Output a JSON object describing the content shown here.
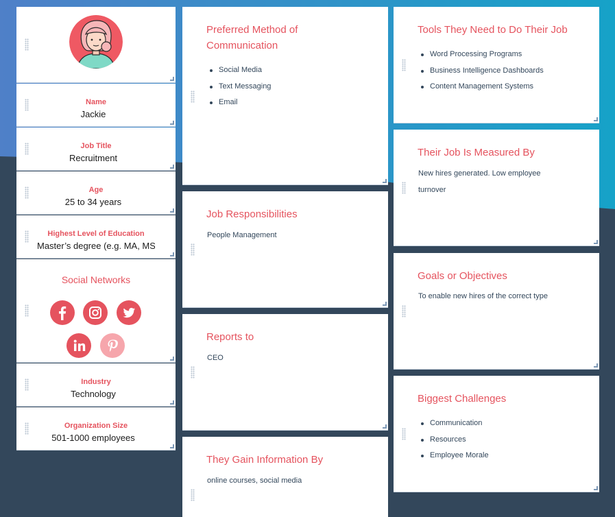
{
  "profile": {
    "name_label": "Name",
    "name_value": "Jackie",
    "job_title_label": "Job Title",
    "job_title_value": "Recruitment",
    "age_label": "Age",
    "age_value": "25 to 34 years",
    "education_label": "Highest Level of Education",
    "education_value": "Master’s degree (e.g. MA, MS",
    "social_title": "Social Networks",
    "social_icons": [
      "facebook-icon",
      "instagram-icon",
      "twitter-icon",
      "linkedin-icon",
      "pinterest-icon"
    ],
    "industry_label": "Industry",
    "industry_value": "Technology",
    "org_size_label": "Organization Size",
    "org_size_value": "501-1000 employees"
  },
  "cards": {
    "communication": {
      "title": "Preferred Method of Communication",
      "items": [
        "Social Media",
        "Text Messaging",
        "Email"
      ]
    },
    "responsibilities": {
      "title": "Job Responsibilities",
      "text": "People Management"
    },
    "reports_to": {
      "title": "Reports to",
      "text": "CEO"
    },
    "information": {
      "title": "They Gain Information By",
      "text": "online courses, social media"
    },
    "tools": {
      "title": "Tools They Need to Do Their Job",
      "items": [
        "Word Processing Programs",
        "Business Intelligence Dashboards",
        "Content Management Systems"
      ]
    },
    "measured": {
      "title": "Their Job Is Measured By",
      "text": "New hires generated. Low employee turnover"
    },
    "goals": {
      "title": "Goals or Objectives",
      "text": "To enable new hires of the correct type"
    },
    "challenges": {
      "title": "Biggest Challenges",
      "items": [
        "Communication",
        "Resources",
        "Employee Morale"
      ]
    }
  },
  "colors": {
    "accent": "#e5535e",
    "accent_faded": "#f6a6ac",
    "text": "#33475b",
    "background_dark": "#33475b",
    "gradient_start": "#4f80c8",
    "gradient_end": "#16a2c8"
  }
}
